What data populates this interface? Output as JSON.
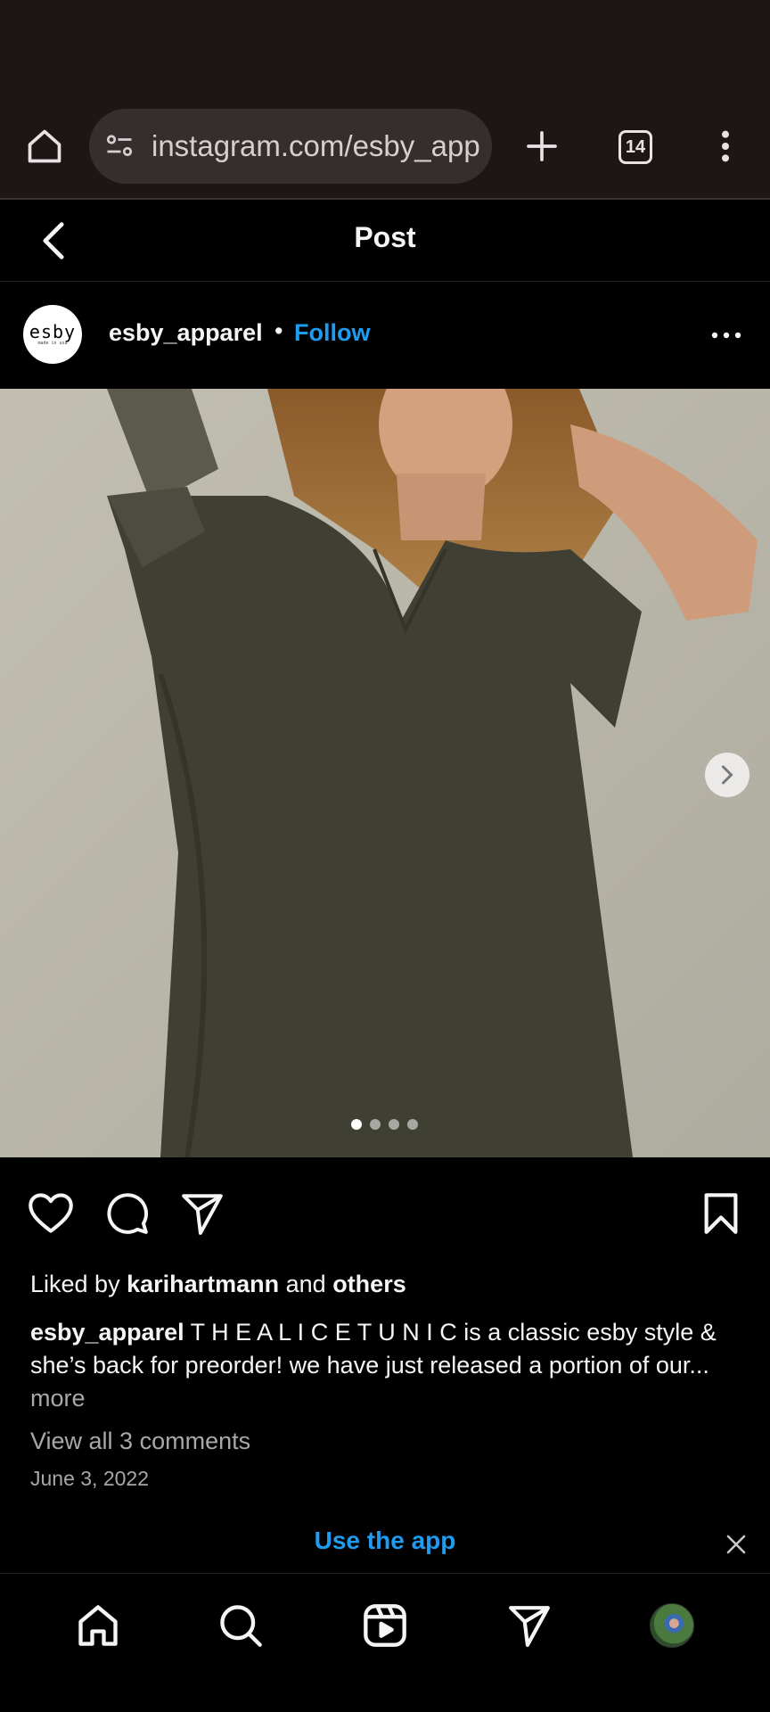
{
  "browser": {
    "url": "instagram.com/esby_apparel",
    "tab_count": "14"
  },
  "header": {
    "title": "Post"
  },
  "author": {
    "logo_text": "esby",
    "logo_subtext": "made in usa",
    "username": "esby_apparel",
    "separator": "•",
    "follow_label": "Follow"
  },
  "carousel": {
    "total_images": 4,
    "current_index": 1
  },
  "post": {
    "liked_prefix": "Liked by ",
    "liked_user": "karihartmann",
    "liked_middle": " and ",
    "liked_others": "others",
    "caption_user": "esby_apparel",
    "caption_text": " T H E A L I C E T U N I C is a classic esby style & she’s back for preorder! we have just released a portion of our...",
    "more_label": " more",
    "comments_label": "View all 3 comments",
    "date": "June 3, 2022"
  },
  "banner": {
    "use_app_label": "Use the app"
  },
  "colors": {
    "accent": "#1f9bf0",
    "browser_bg": "#1d1617",
    "background": "#000000"
  },
  "icons": [
    "home-icon",
    "site-settings-icon",
    "new-tab-icon",
    "tabs-icon",
    "overflow-menu-icon",
    "back-icon",
    "more-icon",
    "carousel-next-icon",
    "heart-icon",
    "comment-icon",
    "share-icon",
    "bookmark-icon",
    "close-icon",
    "search-icon",
    "reels-icon",
    "direct-icon",
    "profile-avatar"
  ]
}
